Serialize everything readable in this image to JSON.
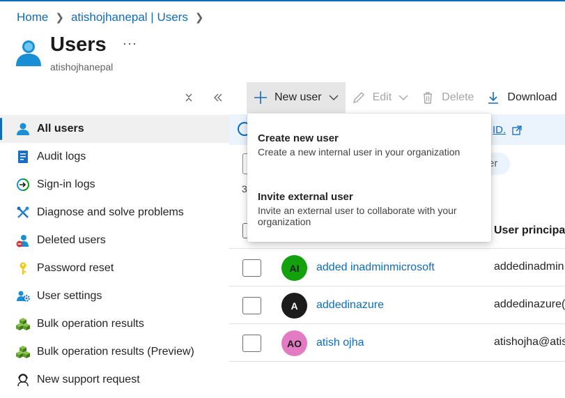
{
  "breadcrumb": {
    "home": "Home",
    "tenant": "atishojhanepal | Users"
  },
  "page": {
    "title": "Users",
    "subtitle": "atishojhanepal",
    "more": "···"
  },
  "sidebar": {
    "items": [
      {
        "label": "All users",
        "icon": "user-icon",
        "active": true
      },
      {
        "label": "Audit logs",
        "icon": "audit-log-icon"
      },
      {
        "label": "Sign-in logs",
        "icon": "sign-in-icon"
      },
      {
        "label": "Diagnose and solve problems",
        "icon": "wrench-icon"
      },
      {
        "label": "Deleted users",
        "icon": "deleted-user-icon"
      },
      {
        "label": "Password reset",
        "icon": "key-icon"
      },
      {
        "label": "User settings",
        "icon": "user-settings-icon"
      },
      {
        "label": "Bulk operation results",
        "icon": "cubes-icon"
      },
      {
        "label": "Bulk operation results (Preview)",
        "icon": "cubes-icon"
      },
      {
        "label": "New support request",
        "icon": "support-icon"
      }
    ]
  },
  "toolbar": {
    "new_user": "New user",
    "edit": "Edit",
    "delete": "Delete",
    "download": "Download"
  },
  "info": {
    "link": "ID."
  },
  "filter": {
    "pill": "er"
  },
  "list": {
    "count": "3"
  },
  "table": {
    "upn_header": "User principal",
    "rows": [
      {
        "initials": "AI",
        "name": "added inadminmicrosoft",
        "upn": "addedinadmin",
        "avatar_color": "#13a10e"
      },
      {
        "initials": "A",
        "name": "addedinazure",
        "upn": "addedinazure(",
        "avatar_color": "#1b1b1b"
      },
      {
        "initials": "AO",
        "name": "atish ojha",
        "upn": "atishojha@atis",
        "avatar_color": "#e37bc2"
      }
    ]
  },
  "dropdown": {
    "items": [
      {
        "title": "Create new user",
        "desc": "Create a new internal user in your organization"
      },
      {
        "title": "Invite external user",
        "desc": "Invite an external user to collaborate with your organization"
      }
    ]
  },
  "colors": {
    "accent": "#0f6cbd",
    "active_bg": "#f0f0f0",
    "info_bg": "#ebf3fc"
  }
}
